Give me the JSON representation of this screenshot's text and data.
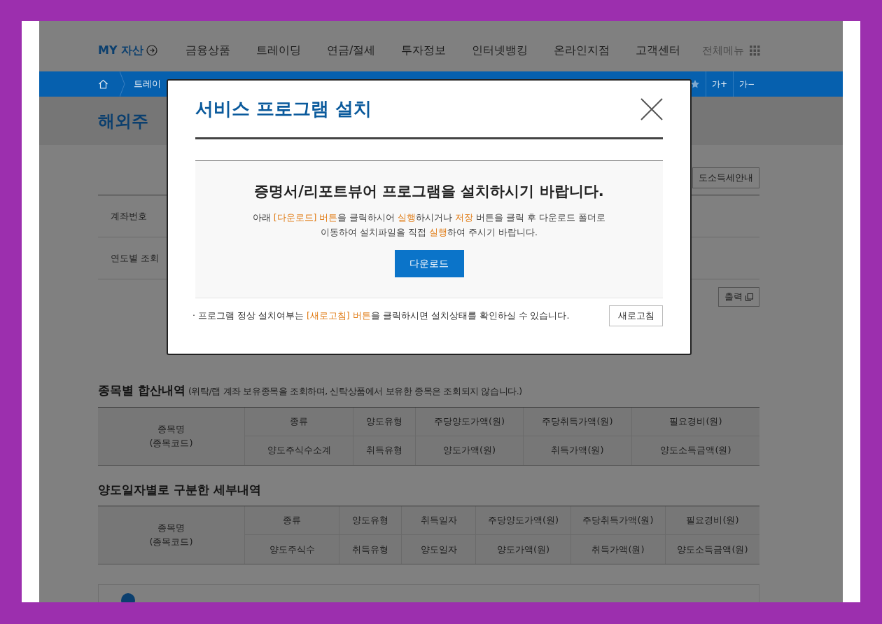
{
  "nav": {
    "my_asset": "MY 자산",
    "items": [
      "금융상품",
      "트레이딩",
      "연금/절세",
      "투자정보",
      "인터넷뱅킹",
      "온라인지점",
      "고객센터"
    ],
    "all_menu": "전체메뉴"
  },
  "breadcrumb": {
    "items": [
      "트레이"
    ],
    "font_buttons": [
      "가+",
      "가−"
    ]
  },
  "page_title": "해외주",
  "guide_button": "도소득세안내",
  "form_rows": [
    {
      "label": "계좌번호"
    },
    {
      "label": "연도별 조회"
    }
  ],
  "print_button": "출력",
  "sections": [
    {
      "title": "종목별 합산내역",
      "note": "(위탁/랩 계좌 보유종목을 조회하며, 신탁상품에서 보유한 종목은 조회되지 않습니다.)",
      "table": {
        "first_column": [
          "종목명",
          "(종목코드)"
        ],
        "header_row_1": [
          "종류",
          "양도유형",
          "주당양도가액(원)",
          "주당취득가액(원)",
          "필요경비(원)"
        ],
        "header_row_2": [
          "양도주식수소계",
          "취득유형",
          "양도가액(원)",
          "취득가액(원)",
          "양도소득금액(원)"
        ]
      }
    },
    {
      "title": "양도일자별로 구분한 세부내역",
      "table": {
        "first_column": [
          "종목명",
          "(종목코드)"
        ],
        "header_row_1": [
          "종류",
          "양도유형",
          "취득일자",
          "주당양도가액(원)",
          "주당취득가액(원)",
          "필요경비(원)"
        ],
        "header_row_2": [
          "양도주식수",
          "취득유형",
          "양도일자",
          "양도가액(원)",
          "취득가액(원)",
          "양도소득금액(원)"
        ]
      }
    }
  ],
  "modal": {
    "title": "서비스 프로그램 설치",
    "heading": "증명서/리포트뷰어 프로그램을 설치하시기 바랍니다.",
    "message_lines": [
      "아래 **[다운로드] 버튼**을 클릭하시어 **실행**하시거나 **저장** 버튼을 클릭 후 다운로드 폴더로",
      "이동하여 설치파일을 직접 **실행**하여 주시기 바랍니다."
    ],
    "download_button": "다운로드",
    "note": "· 프로그램 정상 설치여부는 **[새로고침] 버튼**을 클릭하시면 설치상태를 확인하실 수 있습니다.",
    "refresh_button": "새로고침"
  }
}
